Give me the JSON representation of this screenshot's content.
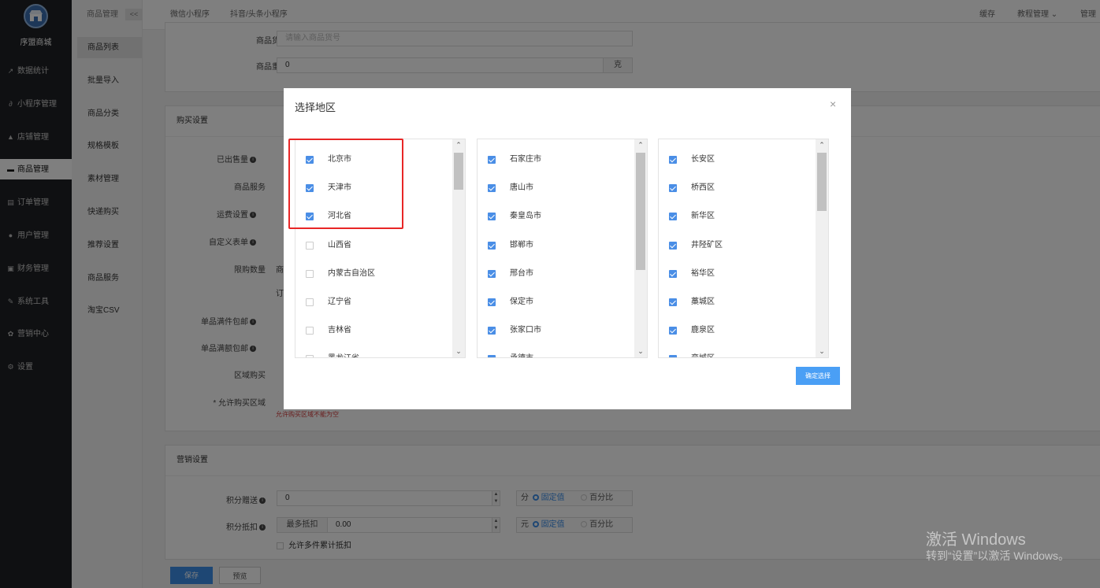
{
  "sidebar": {
    "store_name": "序盟商城",
    "items": [
      {
        "label": "数据统计",
        "icon": "chart-line-icon",
        "glyph": "↗"
      },
      {
        "label": "小程序管理",
        "icon": "link-icon",
        "glyph": "∂"
      },
      {
        "label": "店铺管理",
        "icon": "store-icon",
        "glyph": "▲"
      },
      {
        "label": "商品管理",
        "icon": "goods-icon",
        "glyph": "▬"
      },
      {
        "label": "订单管理",
        "icon": "order-icon",
        "glyph": "▤"
      },
      {
        "label": "用户管理",
        "icon": "user-icon",
        "glyph": "●"
      },
      {
        "label": "财务管理",
        "icon": "finance-icon",
        "glyph": "▣"
      },
      {
        "label": "系统工具",
        "icon": "wrench-icon",
        "glyph": "✎"
      },
      {
        "label": "营销中心",
        "icon": "marketing-icon",
        "glyph": "✿"
      },
      {
        "label": "设置",
        "icon": "gear-icon",
        "glyph": "⚙"
      }
    ]
  },
  "submenu": {
    "title": "商品管理",
    "toggle": "<<",
    "items": [
      "商品列表",
      "批量导入",
      "商品分类",
      "规格模板",
      "素材管理",
      "快递购买",
      "推荐设置",
      "商品服务",
      "淘宝CSV"
    ]
  },
  "header": {
    "tabs": [
      "微信小程序",
      "抖音/头条小程序"
    ],
    "right": [
      "缓存",
      "教程管理",
      "管理员"
    ]
  },
  "form_top": {
    "goods_no_label": "商品货号",
    "goods_no_placeholder": "请输入商品货号",
    "weight_label": "商品重量",
    "weight_value": "0",
    "weight_unit": "克"
  },
  "purchase": {
    "title": "购买设置",
    "labels": [
      "已出售量",
      "商品服务",
      "运费设置",
      "自定义表单",
      "限购数量",
      "单品满件包邮",
      "单品满额包邮",
      "区域购买"
    ],
    "region_label": "* 允许购买区域",
    "region_error": "允许购买区域不能为空",
    "limit_text1": "商",
    "limit_text2": "订"
  },
  "marketing": {
    "title": "营销设置",
    "points_give_label": "积分赠送",
    "points_give_value": "0",
    "points_give_unit": "分",
    "points_deduct_label": "积分抵扣",
    "points_deduct_prefix": "最多抵扣",
    "points_deduct_value": "0.00",
    "points_deduct_unit": "元",
    "fixed_label": "固定值",
    "percent_label": "百分比",
    "multi_label": "允许多件累计抵扣"
  },
  "footer": {
    "save": "保存",
    "preview": "预览"
  },
  "modal": {
    "title": "选择地区",
    "close": "×",
    "confirm": "确定选择",
    "columns": [
      {
        "items": [
          {
            "label": "北京市",
            "checked": true
          },
          {
            "label": "天津市",
            "checked": true
          },
          {
            "label": "河北省",
            "checked": true
          },
          {
            "label": "山西省",
            "checked": false
          },
          {
            "label": "内蒙古自治区",
            "checked": false
          },
          {
            "label": "辽宁省",
            "checked": false
          },
          {
            "label": "吉林省",
            "checked": false
          },
          {
            "label": "黑龙江省",
            "checked": false
          }
        ]
      },
      {
        "items": [
          {
            "label": "石家庄市",
            "checked": true
          },
          {
            "label": "唐山市",
            "checked": true
          },
          {
            "label": "秦皇岛市",
            "checked": true
          },
          {
            "label": "邯郸市",
            "checked": true
          },
          {
            "label": "邢台市",
            "checked": true
          },
          {
            "label": "保定市",
            "checked": true
          },
          {
            "label": "张家口市",
            "checked": true
          },
          {
            "label": "承德市",
            "checked": true
          }
        ]
      },
      {
        "items": [
          {
            "label": "长安区",
            "checked": true
          },
          {
            "label": "桥西区",
            "checked": true
          },
          {
            "label": "新华区",
            "checked": true
          },
          {
            "label": "井陉矿区",
            "checked": true
          },
          {
            "label": "裕华区",
            "checked": true
          },
          {
            "label": "藁城区",
            "checked": true
          },
          {
            "label": "鹿泉区",
            "checked": true
          },
          {
            "label": "栾城区",
            "checked": true
          }
        ]
      }
    ]
  },
  "watermark": {
    "line1": "激活 Windows",
    "line2": "转到“设置”以激活 Windows。"
  },
  "colors": {
    "accent": "#3d8ee8",
    "sidebar_bg": "#1f2124",
    "highlight": "#e82626"
  }
}
